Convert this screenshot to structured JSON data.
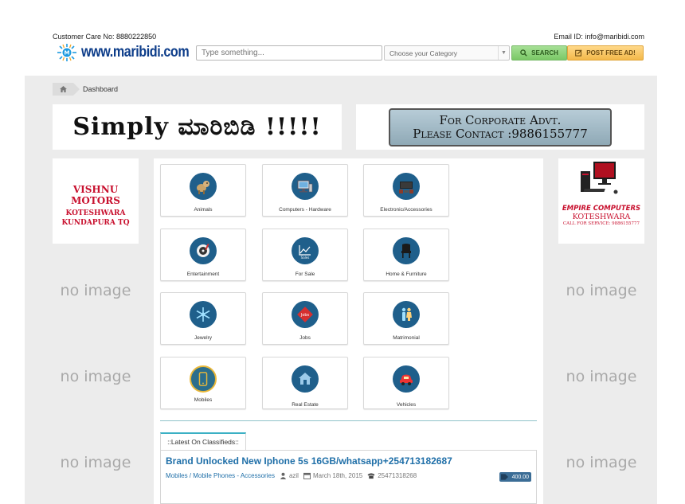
{
  "header": {
    "customer_care_label": "Customer Care No: ",
    "customer_care_number": "8880222850",
    "email_label": "Email ID: ",
    "email_value": "info@maribidi.com",
    "logo_text": "www.maribidi.com",
    "search": {
      "placeholder": "Type something..."
    },
    "category": {
      "selected": "Choose your Category"
    },
    "search_button": "SEARCH",
    "post_button": "POST FREE AD!"
  },
  "breadcrumb": {
    "current": "Dashboard"
  },
  "banners": {
    "left": "Simply ಮಾರಿಬಿಡಿ !!!!!",
    "right_line1": "For Corporate Advt.",
    "right_line2": "Please Contact :9886155777"
  },
  "side_ads": {
    "left": {
      "line1": "VISHNU MOTORS",
      "line2": "KOTESHWARA",
      "line3": "KUNDAPURA TQ"
    },
    "right": {
      "line1": "EMPIRE COMPUTERS",
      "line2": "KOTESHWARA",
      "line3": "CALL FOR SERVICE: 9886155777"
    }
  },
  "no_image_text": "no image",
  "categories": [
    {
      "label": "Animals",
      "icon": "animals-icon"
    },
    {
      "label": "Computers - Hardware",
      "icon": "computer-icon"
    },
    {
      "label": "Electronic/Accessories",
      "icon": "electronics-icon"
    },
    {
      "label": "Entertainment",
      "icon": "entertainment-icon"
    },
    {
      "label": "For Sale",
      "icon": "chart-icon"
    },
    {
      "label": "Home & Furniture",
      "icon": "chair-icon"
    },
    {
      "label": "Jewelry",
      "icon": "snowflake-icon"
    },
    {
      "label": "Jobs",
      "icon": "jobs-icon"
    },
    {
      "label": "Matrimonial",
      "icon": "couple-icon"
    },
    {
      "label": "Mobiles",
      "icon": "mobile-icon"
    },
    {
      "label": "Real Estate",
      "icon": "house-icon"
    },
    {
      "label": "Vehicles",
      "icon": "car-icon"
    }
  ],
  "latest": {
    "tab_label": "::Latest On Classifieds::",
    "ad": {
      "title": "Brand Unlocked New Iphone 5s 16GB/whatsapp+254713182687",
      "category": "Mobiles / Mobile Phones - Accessories",
      "user": "azil",
      "date": "March 18th, 2015",
      "phone": "25471318268",
      "price": "400.00"
    }
  },
  "colors": {
    "accent": "#1f5f8b",
    "link": "#1f6fa8",
    "search_button": "#8cd27a",
    "post_button": "#f5c15c",
    "ad_red": "#c8102e"
  }
}
